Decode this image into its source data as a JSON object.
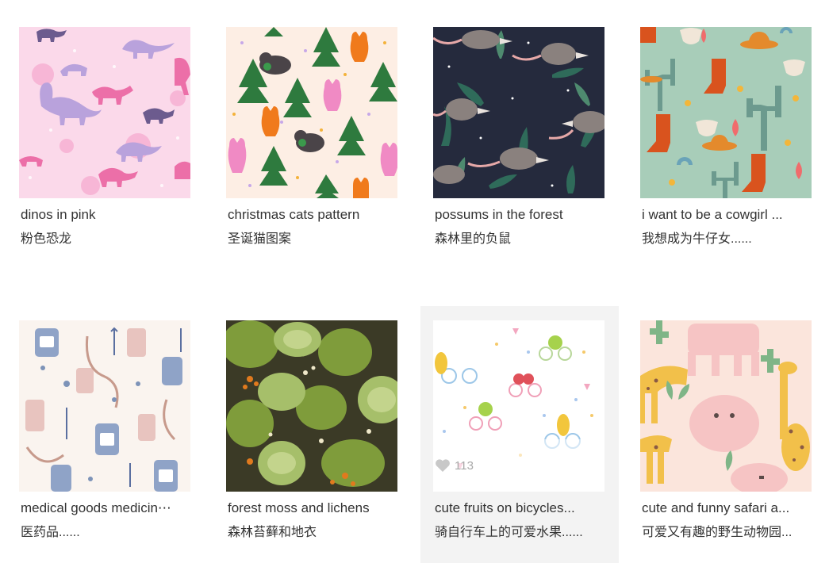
{
  "cards": [
    {
      "title": "dinos in pink",
      "subtitle": "粉色恐龙"
    },
    {
      "title": "christmas cats pattern",
      "subtitle": "圣诞猫图案"
    },
    {
      "title": "possums in the forest",
      "subtitle": "森林里的负鼠"
    },
    {
      "title": "i want to be a cowgirl ...",
      "subtitle": "我想成为牛仔女......"
    },
    {
      "title": "medical goods medicin⋯",
      "subtitle": "医药品......"
    },
    {
      "title": "forest moss and lichens",
      "subtitle": "森林苔藓和地衣"
    },
    {
      "title": "cute fruits on bicycles...",
      "subtitle": "骑自行车上的可爱水果......",
      "likes": "113"
    },
    {
      "title": "cute and funny safari a...",
      "subtitle": "可爱又有趣的野生动物园..."
    }
  ],
  "colors": {
    "hover_bg": "#f3f3f3",
    "title_text": "#333333",
    "likes_text": "#a8a8a8"
  },
  "icons": {
    "likes": "heart-icon"
  }
}
